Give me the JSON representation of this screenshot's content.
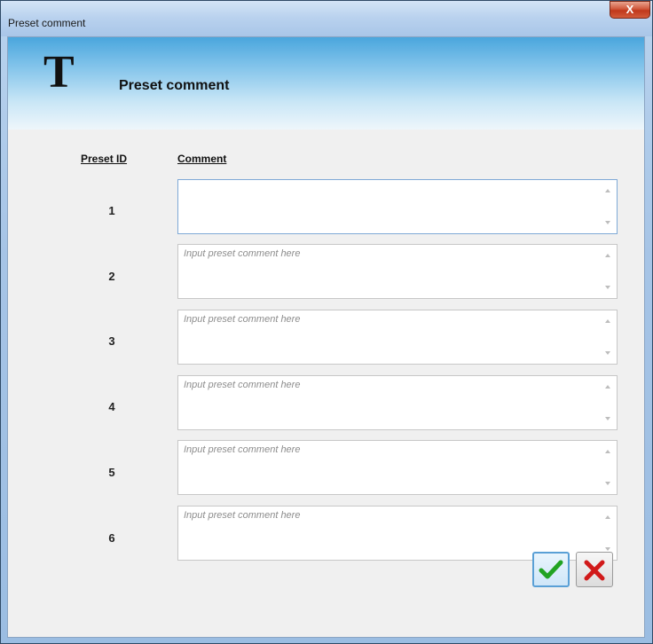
{
  "window": {
    "title": "Preset comment",
    "close_label": "X"
  },
  "header": {
    "icon_letter": "T",
    "title": "Preset comment"
  },
  "columns": {
    "id_header": "Preset ID",
    "comment_header": "Comment"
  },
  "rows": [
    {
      "id": "1",
      "value": "",
      "placeholder": ""
    },
    {
      "id": "2",
      "value": "",
      "placeholder": "Input preset comment here"
    },
    {
      "id": "3",
      "value": "",
      "placeholder": "Input preset comment here"
    },
    {
      "id": "4",
      "value": "",
      "placeholder": "Input preset comment here"
    },
    {
      "id": "5",
      "value": "",
      "placeholder": "Input preset comment here"
    },
    {
      "id": "6",
      "value": "",
      "placeholder": "Input preset comment here"
    }
  ],
  "buttons": {
    "ok_icon": "checkmark-icon",
    "cancel_icon": "cross-icon"
  },
  "colors": {
    "ok_green": "#22a322",
    "cancel_red": "#d11a1a",
    "header_blue": "#4aa6dd"
  }
}
